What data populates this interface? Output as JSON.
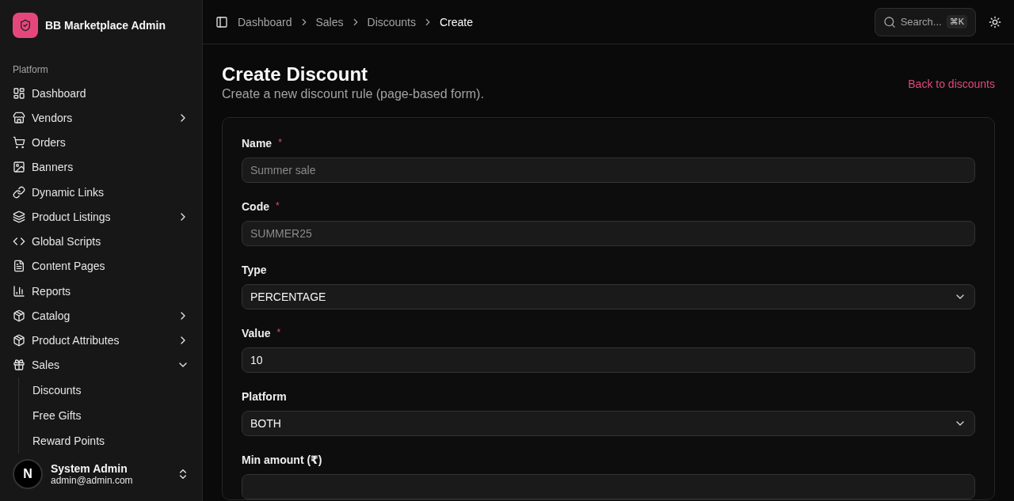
{
  "sidebar": {
    "app_name": "BB Marketplace Admin",
    "section_label": "Platform",
    "items": [
      {
        "kind": "link",
        "label": "Dashboard"
      },
      {
        "kind": "group",
        "label": "Vendors",
        "expanded": false
      },
      {
        "kind": "link",
        "label": "Orders"
      },
      {
        "kind": "link",
        "label": "Banners"
      },
      {
        "kind": "link",
        "label": "Dynamic Links"
      },
      {
        "kind": "group",
        "label": "Product Listings",
        "expanded": false
      },
      {
        "kind": "link",
        "label": "Global Scripts"
      },
      {
        "kind": "link",
        "label": "Content Pages"
      },
      {
        "kind": "link",
        "label": "Reports"
      },
      {
        "kind": "group",
        "label": "Catalog",
        "expanded": false
      },
      {
        "kind": "group",
        "label": "Product Attributes",
        "expanded": false
      },
      {
        "kind": "group",
        "label": "Sales",
        "expanded": true,
        "children": [
          {
            "label": "Discounts"
          },
          {
            "label": "Free Gifts"
          },
          {
            "label": "Reward Points"
          }
        ]
      }
    ],
    "user": {
      "avatar_letter": "N",
      "name": "System Admin",
      "email": "admin@admin.com"
    }
  },
  "breadcrumbs": [
    {
      "label": "Dashboard",
      "selected": false
    },
    {
      "label": "Sales",
      "selected": false
    },
    {
      "label": "Discounts",
      "selected": false
    },
    {
      "label": "Create",
      "selected": true
    }
  ],
  "search": {
    "placeholder": "Search...",
    "shortcut": "⌘K"
  },
  "page": {
    "title": "Create Discount",
    "subtitle": "Create a new discount rule (page-based form).",
    "back_link": "Back to discounts"
  },
  "form": {
    "fields": [
      {
        "kind": "text",
        "label": "Name",
        "required_mark": "*",
        "placeholder": "Summer sale"
      },
      {
        "kind": "text",
        "label": "Code",
        "required_mark": "*",
        "placeholder": "SUMMER25"
      },
      {
        "kind": "select",
        "label": "Type",
        "value": "PERCENTAGE"
      },
      {
        "kind": "text",
        "label": "Value",
        "required_mark": "*",
        "value": "10"
      },
      {
        "kind": "select",
        "label": "Platform",
        "value": "BOTH"
      },
      {
        "kind": "text",
        "label": "Min amount (₹)"
      }
    ]
  }
}
